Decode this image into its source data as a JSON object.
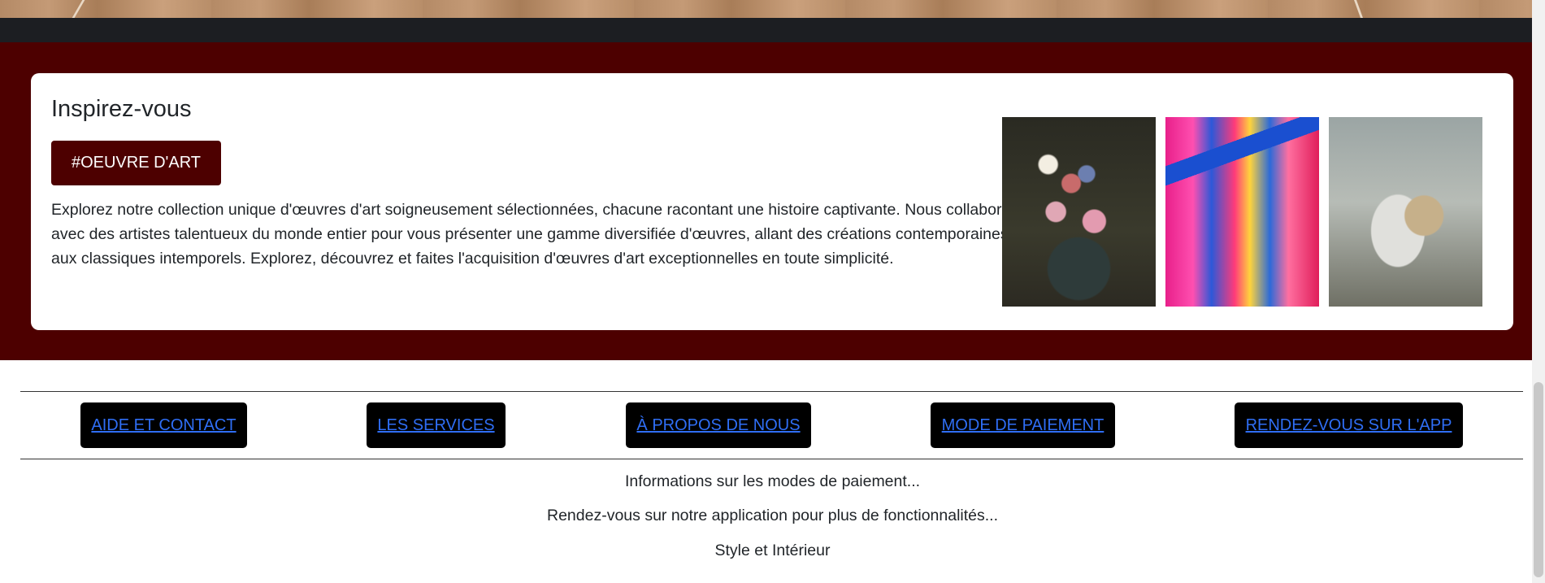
{
  "inspire": {
    "title": "Inspirez-vous",
    "tag_button": "#OEUVRE D'ART",
    "description": "Explorez notre collection unique d'œuvres d'art soigneusement sélectionnées, chacune racontant une histoire captivante. Nous collaborons avec des artistes talentueux du monde entier pour vous présenter une gamme diversifiée d'œuvres, allant des créations contemporaines aux classiques intemporels. Explorez, découvrez et faites l'acquisition d'œuvres d'art exceptionnelles en toute simplicité.",
    "artworks": [
      "floral-still-life-painting",
      "abstract-colorful-painting",
      "sailing-ship-painting"
    ]
  },
  "footer": {
    "nav": [
      {
        "label": "AIDE ET CONTACT"
      },
      {
        "label": "LES SERVICES"
      },
      {
        "label": "À PROPOS DE NOUS"
      },
      {
        "label": "MODE DE PAIEMENT"
      },
      {
        "label": "RENDEZ-VOUS SUR L'APP"
      }
    ],
    "lines": [
      "Informations sur les modes de paiement...",
      "Rendez-vous sur notre application pour plus de fonctionnalités...",
      "Style et Intérieur"
    ]
  },
  "colors": {
    "brand_maroon": "#4d0000",
    "dark_band": "#1c1e22",
    "link_blue": "#2f6ef5",
    "nav_button_bg": "#000000"
  }
}
